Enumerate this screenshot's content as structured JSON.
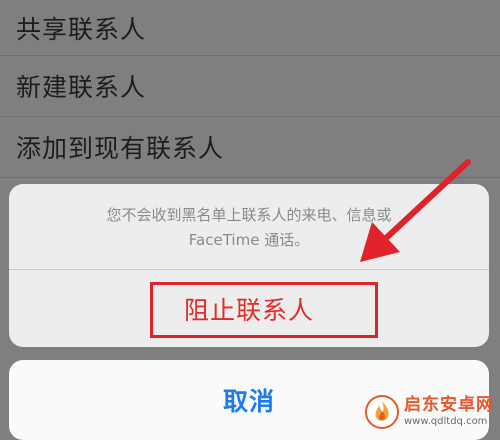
{
  "background_list": {
    "items": [
      {
        "label": "共享联系人"
      },
      {
        "label": "新建联系人"
      },
      {
        "label": "添加到现有联系人"
      }
    ]
  },
  "action_sheet": {
    "message_line1": "您不会收到黑名单上联系人的来电、信息或",
    "message_line2": "FaceTime 通话。",
    "block_label": "阻止联系人",
    "cancel_label": "取消"
  },
  "annotation": {
    "highlight_color": "#e0222a",
    "arrow_color": "#e0222a"
  },
  "watermark": {
    "title": "启东安卓网",
    "url": "www.qdltdq.com",
    "icon": "flame-logo-icon"
  },
  "colors": {
    "destructive": "#e42a2a",
    "accent": "#1d7bf0",
    "dim_overlay": "#7f7f7f"
  }
}
